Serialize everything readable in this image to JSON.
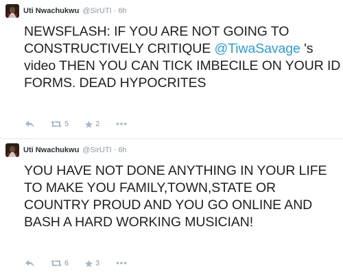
{
  "tweets": [
    {
      "name": "Uti Nwachukwu",
      "handle": "@SirUTI",
      "separator": "·",
      "time": "6h",
      "text_before": "NEWSFLASH: IF YOU ARE NOT GOING TO CONSTRUCTIVELY CRITIQUE ",
      "mention": "@TiwaSavage",
      "text_after": " 's video THEN YOU CAN TICK IMBECILE ON YOUR ID FORMS. DEAD HYPOCRITES",
      "retweets": "5",
      "favorites": "2",
      "more": "•••"
    },
    {
      "name": "Uti Nwachukwu",
      "handle": "@SirUTI",
      "separator": "·",
      "time": "6h",
      "text": "YOU HAVE NOT DONE ANYTHING IN YOUR LIFE TO MAKE YOU FAMILY,TOWN,STATE OR COUNTRY PROUD AND YOU GO ONLINE AND BASH A HARD WORKING MUSICIAN!",
      "retweets": "6",
      "favorites": "3",
      "more": "•••"
    }
  ],
  "icons": {
    "reply": "reply-icon",
    "retweet": "retweet-icon",
    "favorite": "star-icon",
    "more": "more-icon"
  },
  "colors": {
    "mention": "#2b9bd1",
    "meta": "#8899a6",
    "action": "#aab8c2"
  }
}
